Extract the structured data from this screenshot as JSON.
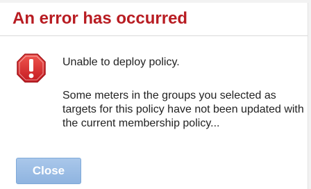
{
  "dialog": {
    "title": "An error has occurred",
    "icon": "error-octagon-icon",
    "headline": "Unable to deploy policy.",
    "message": "Some meters in the groups you selected as targets for this policy have not been updated with the current membership policy...",
    "close_label": "Close"
  },
  "colors": {
    "title": "#b81c22",
    "icon": "#d9262c",
    "button": "#9bbde6"
  }
}
